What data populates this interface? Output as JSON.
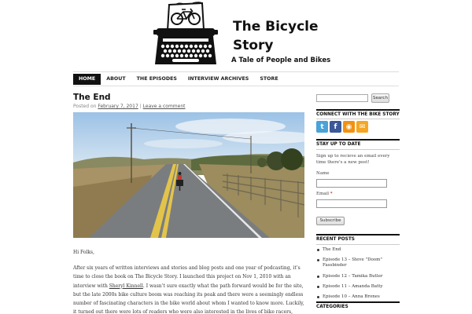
{
  "site": {
    "title_line1": "The Bicycle",
    "title_line2": "Story",
    "tagline": "A Tale of People and Bikes"
  },
  "nav": {
    "items": [
      {
        "label": "HOME",
        "active": true
      },
      {
        "label": "ABOUT",
        "active": false
      },
      {
        "label": "THE EPISODES",
        "active": false
      },
      {
        "label": "INTERVIEW ARCHIVES",
        "active": false
      },
      {
        "label": "STORE",
        "active": false
      }
    ]
  },
  "post": {
    "title": "The End",
    "meta_prefix": "Posted on",
    "date": "February 7, 2017",
    "separator": "|",
    "comment_link": "Leave a comment",
    "paragraph1": "Hi Folks,",
    "paragraph2_a": "After six years of written interviews and stories and blog posts and one year of podcasting, it’s time to close the book on The Bicycle Story. I launched this project on Nov 1, 2010 with an interview with ",
    "paragraph2_link": "Sheryl Kinnell",
    "paragraph2_b": ". I wasn’t sure exactly what the path forward would be for the site, but the late 2000s bike culture boom was reaching its peak and there were a seemingly endless number of fascinating characters in the bike world about whom I wanted to know more. Luckily, it turned out there were lots of readers who were also interested in the lives of bike racers,"
  },
  "sidebar": {
    "search_button": "Search",
    "search_value": "",
    "connect_title": "CONNECT WITH THE BIKE STORY",
    "social_icons": [
      {
        "name": "twitter-icon",
        "glyph": "t",
        "color": "#4aa3d8"
      },
      {
        "name": "facebook-icon",
        "glyph": "f",
        "color": "#3b5998"
      },
      {
        "name": "rss-icon",
        "glyph": "◉",
        "color": "#f29111"
      },
      {
        "name": "email-icon",
        "glyph": "✉",
        "color": "#f5a623"
      }
    ],
    "upto_title": "STAY UP TO DATE",
    "upto_text": "Sign up to recieve an email every time there's a new post!",
    "name_label": "Name",
    "email_label": "Email",
    "email_required": "*",
    "subscribe_button": "Subscribe",
    "recent_title": "RECENT POSTS",
    "recent_posts": [
      "The End",
      "Episode 13 – Steve \"Doom\" Fassbinder",
      "Episode 12 – Tamika Butler",
      "Episode 11 – Amanda Batty",
      "Episode 10 – Anna Brones"
    ],
    "categories_title": "CATEGORIES"
  },
  "colors": {
    "nav_active_bg": "#111111",
    "link": "#555555"
  }
}
